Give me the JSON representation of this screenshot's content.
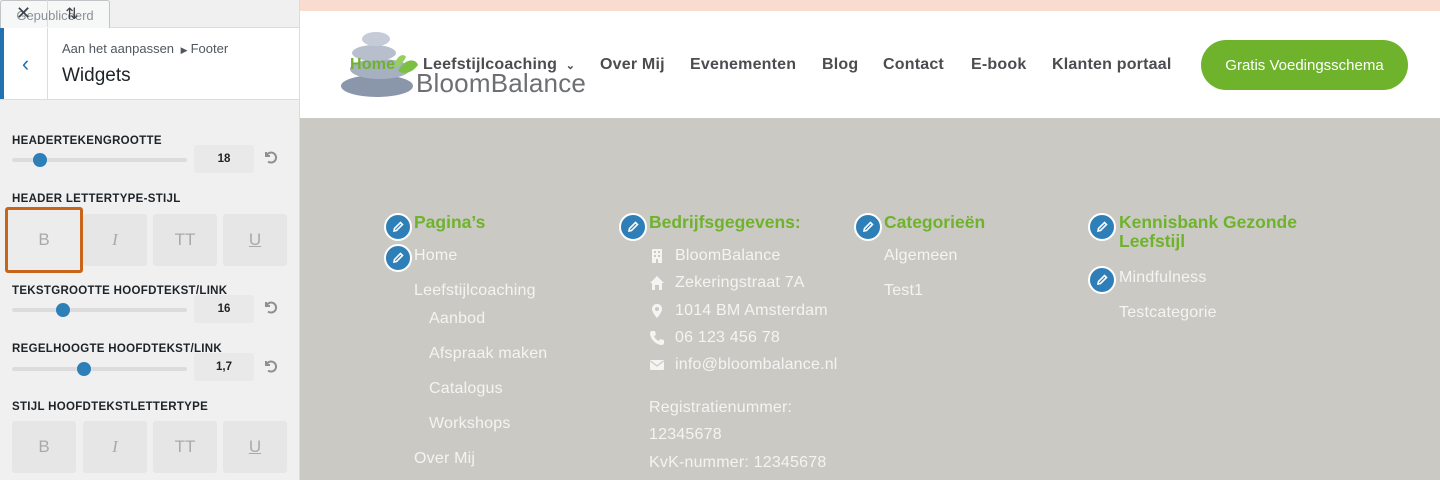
{
  "customizer": {
    "close_icon": "close-icon",
    "reorder_icon": "reorder-icon",
    "publish_label": "Gepubliceerd",
    "breadcrumb_prefix": "Aan het aanpassen",
    "breadcrumb_section": "Footer",
    "panel_title": "Widgets",
    "controls": {
      "header_font_size": {
        "label": "HEADERTEKENGROOTTE",
        "value": "18",
        "level": 0.16
      },
      "header_font_style": {
        "label": "HEADER LETTERTYPE-STIJL"
      },
      "body_font_size": {
        "label": "TEKSTGROOTTE HOOFDTEKST/LINK",
        "value": "16",
        "level": 0.29
      },
      "body_line_height": {
        "label": "REGELHOOGTE HOOFDTEKST/LINK",
        "value": "1,7",
        "level": 0.41
      },
      "body_font_style": {
        "label": "STIJL HOOFDTEKSTLETTERTYPE"
      }
    },
    "style_buttons": {
      "bold": "B",
      "italic": "I",
      "caps": "TT",
      "underline": "U"
    }
  },
  "site": {
    "logo_text": "BloomBalance",
    "nav": [
      "Home",
      "Leefstijlcoaching",
      "Over Mij",
      "Evenementen",
      "Blog",
      "Contact",
      "E-book",
      "Klanten portaal"
    ],
    "cta": "Gratis Voedingsschema",
    "brand_color": "#6fb32c",
    "footer_bg": "#cbc9c3"
  },
  "footer": {
    "pages": {
      "title": "Pagina’s",
      "links": [
        "Home",
        "Leefstijlcoaching"
      ],
      "sublinks": [
        "Aanbod",
        "Afspraak maken",
        "Catalogus",
        "Workshops"
      ],
      "more": [
        "Over Mij"
      ]
    },
    "company": {
      "title": "Bedrijfsgegevens:",
      "name": "BloomBalance",
      "street": "Zekeringstraat 7A",
      "city": "1014 BM Amsterdam",
      "phone": "06 123 456 78",
      "email": "info@bloombalance.nl",
      "reg_label": "Registratienummer:",
      "reg_number": "12345678",
      "kvk": "KvK-nummer: 12345678"
    },
    "categories": {
      "title": "Categorieën",
      "items": [
        "Algemeen",
        "Test1"
      ]
    },
    "knowledge": {
      "title": "Kennisbank Gezonde Leefstijl",
      "items": [
        "Mindfulness",
        "Testcategorie"
      ]
    }
  }
}
